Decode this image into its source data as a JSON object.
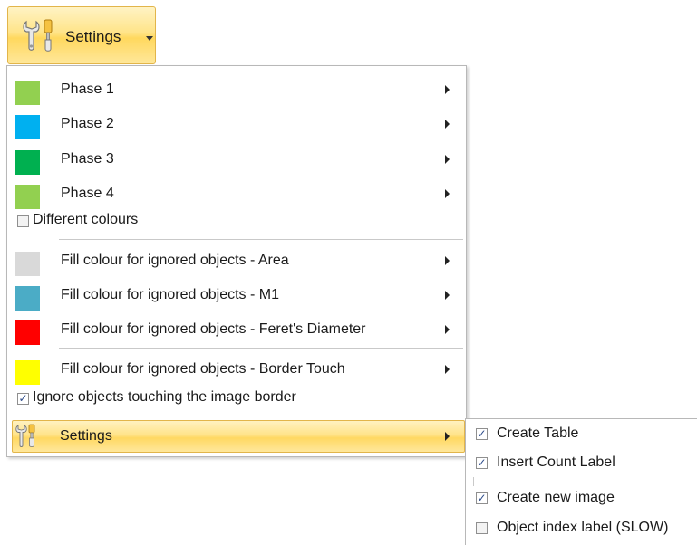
{
  "ribbon": {
    "settings_label": "Settings",
    "icon": "wrench-screwdriver-icon"
  },
  "menu": {
    "phases": [
      {
        "label": "Phase 1",
        "color": "#92d050"
      },
      {
        "label": "Phase 2",
        "color": "#00b0f0"
      },
      {
        "label": "Phase 3",
        "color": "#00b050"
      },
      {
        "label": "Phase 4",
        "color": "#92d050"
      }
    ],
    "different_colours": {
      "label": "Different colours",
      "checked": false
    },
    "fills": [
      {
        "label": "Fill colour for ignored objects - Area",
        "color": "#d9d9d9"
      },
      {
        "label": "Fill colour for ignored objects - M1",
        "color": "#4bacc6"
      },
      {
        "label": "Fill colour for ignored objects - Feret's Diameter",
        "color": "#ff0000"
      },
      {
        "label": "Fill colour for ignored objects - Border Touch",
        "color": "#ffff00"
      }
    ],
    "ignore_border": {
      "label": "Ignore objects touching the image border",
      "checked": true
    },
    "settings_label": "Settings"
  },
  "submenu": {
    "items": [
      {
        "label": "Create Table",
        "checked": true
      },
      {
        "label": "Insert Count Label",
        "checked": true
      },
      {
        "label": "Create new image",
        "checked": true
      },
      {
        "label": "Object index label (SLOW)",
        "checked": false
      }
    ]
  },
  "check_glyph": "✓"
}
